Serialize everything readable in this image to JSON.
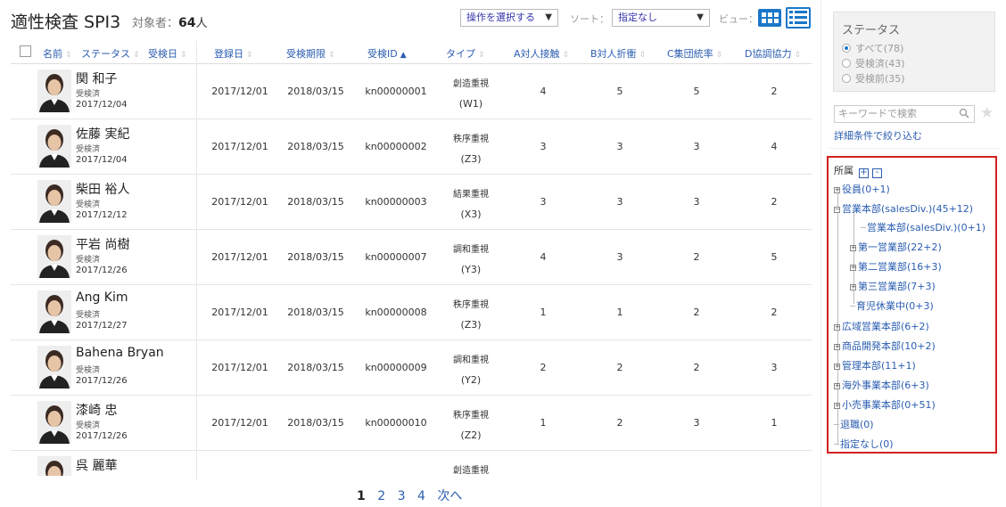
{
  "header": {
    "title": "適性検査 SPI3",
    "target_label": "対象者：",
    "target_count": "64",
    "target_unit": "人",
    "ops_select": "操作を選択する",
    "sort_label": "ソート：",
    "sort_value": "指定なし",
    "view_label": "ビュー："
  },
  "columns": {
    "name": "名前",
    "status": "ステータス",
    "exam_date": "受検日",
    "reg_date": "登録日",
    "deadline": "受検期限",
    "exam_id": "受検ID",
    "type": "タイプ",
    "a": "A対人接触",
    "b": "B対人折衝",
    "c": "C集団統率",
    "d": "D協調協力"
  },
  "rows": [
    {
      "name": "関 和子",
      "status": "受検済",
      "exam_date": "2017/12/04",
      "reg": "2017/12/01",
      "deadline": "2018/03/15",
      "id": "kn00000001",
      "type": "創造重視",
      "code": "(W1)",
      "a": "4",
      "b": "5",
      "c": "5",
      "d": "2"
    },
    {
      "name": "佐藤 実紀",
      "status": "受検済",
      "exam_date": "2017/12/04",
      "reg": "2017/12/01",
      "deadline": "2018/03/15",
      "id": "kn00000002",
      "type": "秩序重視",
      "code": "(Z3)",
      "a": "3",
      "b": "3",
      "c": "3",
      "d": "4"
    },
    {
      "name": "柴田 裕人",
      "status": "受検済",
      "exam_date": "2017/12/12",
      "reg": "2017/12/01",
      "deadline": "2018/03/15",
      "id": "kn00000003",
      "type": "結果重視",
      "code": "(X3)",
      "a": "3",
      "b": "3",
      "c": "3",
      "d": "2"
    },
    {
      "name": "平岩 尚樹",
      "status": "受検済",
      "exam_date": "2017/12/26",
      "reg": "2017/12/01",
      "deadline": "2018/03/15",
      "id": "kn00000007",
      "type": "調和重視",
      "code": "(Y3)",
      "a": "4",
      "b": "3",
      "c": "2",
      "d": "5"
    },
    {
      "name": "Ang Kim",
      "status": "受検済",
      "exam_date": "2017/12/27",
      "reg": "2017/12/01",
      "deadline": "2018/03/15",
      "id": "kn00000008",
      "type": "秩序重視",
      "code": "(Z3)",
      "a": "1",
      "b": "1",
      "c": "2",
      "d": "2"
    },
    {
      "name": "Bahena Bryan",
      "status": "受検済",
      "exam_date": "2017/12/26",
      "reg": "2017/12/01",
      "deadline": "2018/03/15",
      "id": "kn00000009",
      "type": "調和重視",
      "code": "(Y2)",
      "a": "2",
      "b": "2",
      "c": "2",
      "d": "3"
    },
    {
      "name": "漆崎 忠",
      "status": "受検済",
      "exam_date": "2017/12/26",
      "reg": "2017/12/01",
      "deadline": "2018/03/15",
      "id": "kn00000010",
      "type": "秩序重視",
      "code": "(Z2)",
      "a": "1",
      "b": "2",
      "c": "3",
      "d": "1"
    },
    {
      "name": "呉 麗華",
      "type": "創造重視"
    }
  ],
  "pagination": [
    "1",
    "2",
    "3",
    "4",
    "次へ"
  ],
  "sidebar": {
    "status_title": "ステータス",
    "status_options": [
      "すべて(78)",
      "受検済(43)",
      "受検前(35)"
    ],
    "keyword_placeholder": "キーワードで検索",
    "detail_link": "詳細条件で絞り込む",
    "tree_title": "所属",
    "tree_expand": "+",
    "tree_collapse": "-",
    "tree": [
      "役員(0+1)",
      "営業本部(salesDiv.)(45+12)",
      "営業本部(salesDiv.)(0+1)",
      "第一営業部(22+2)",
      "第二営業部(16+3)",
      "第三営業部(7+3)",
      "育児休業中(0+3)",
      "広域営業本部(6+2)",
      "商品開発本部(10+2)",
      "管理本部(11+1)",
      "海外事業本部(6+3)",
      "小売事業本部(0+51)",
      "退職(0)",
      "指定なし(0)"
    ]
  },
  "colors": {
    "accent": "#1976c8",
    "link": "#2a5db0",
    "highlight_border": "#d32020"
  }
}
